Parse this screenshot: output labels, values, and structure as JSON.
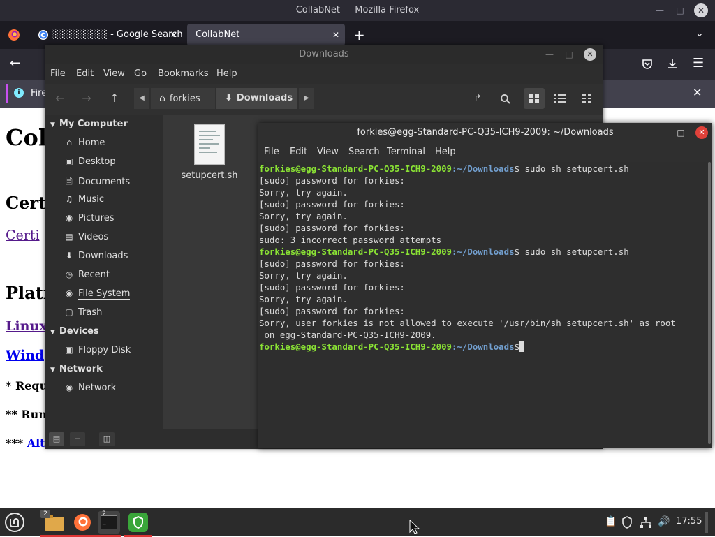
{
  "firefox": {
    "window_title": "CollabNet — Mozilla Firefox",
    "tabs": [
      {
        "label": "░░░░░░░░ - Google Search"
      },
      {
        "label": "CollabNet"
      }
    ],
    "infobar_text": "Fire",
    "page": {
      "heading": "Col",
      "section1": "Cert",
      "link1": "Certi",
      "section2": "Platf",
      "link_linux": "Linux",
      "link_windows": "Wind",
      "note1": "* Requ",
      "note2": "** Run",
      "note3_prefix": "*** ",
      "note3_link": "Alt"
    }
  },
  "nemo": {
    "title": "Downloads",
    "menu": [
      "File",
      "Edit",
      "View",
      "Go",
      "Bookmarks",
      "Help"
    ],
    "breadcrumbs": [
      {
        "label": "forkies"
      },
      {
        "label": "Downloads"
      }
    ],
    "sidebar": {
      "my_computer": "My Computer",
      "items": [
        {
          "label": "Home"
        },
        {
          "label": "Desktop"
        },
        {
          "label": "Documents"
        },
        {
          "label": "Music"
        },
        {
          "label": "Pictures"
        },
        {
          "label": "Videos"
        },
        {
          "label": "Downloads"
        },
        {
          "label": "Recent"
        },
        {
          "label": "File System"
        },
        {
          "label": "Trash"
        }
      ],
      "devices": "Devices",
      "device_items": [
        {
          "label": "Floppy Disk"
        }
      ],
      "network": "Network",
      "network_items": [
        {
          "label": "Network"
        }
      ]
    },
    "files": [
      {
        "name": "setupcert.sh"
      }
    ]
  },
  "terminal": {
    "title": "forkies@egg-Standard-PC-Q35-ICH9-2009: ~/Downloads",
    "menu": [
      "File",
      "Edit",
      "View",
      "Search",
      "Terminal",
      "Help"
    ],
    "prompt_user": "forkies@egg-Standard-PC-Q35-ICH9-2009",
    "prompt_path": ":~/Downloads",
    "prompt_symbol": "$",
    "command": " sudo sh setupcert.sh",
    "lines": [
      "[sudo] password for forkies:",
      "Sorry, try again.",
      "[sudo] password for forkies:",
      "Sorry, try again.",
      "[sudo] password for forkies:",
      "sudo: 3 incorrect password attempts",
      "[sudo] password for forkies:",
      "Sorry, try again.",
      "[sudo] password for forkies:",
      "Sorry, try again.",
      "[sudo] password for forkies:",
      "Sorry, user forkies is not allowed to execute '/usr/bin/sh setupcert.sh' as root",
      " on egg-Standard-PC-Q35-ICH9-2009."
    ]
  },
  "panel": {
    "files_count": "2",
    "terminal_count": "2",
    "clock": "17:55"
  }
}
